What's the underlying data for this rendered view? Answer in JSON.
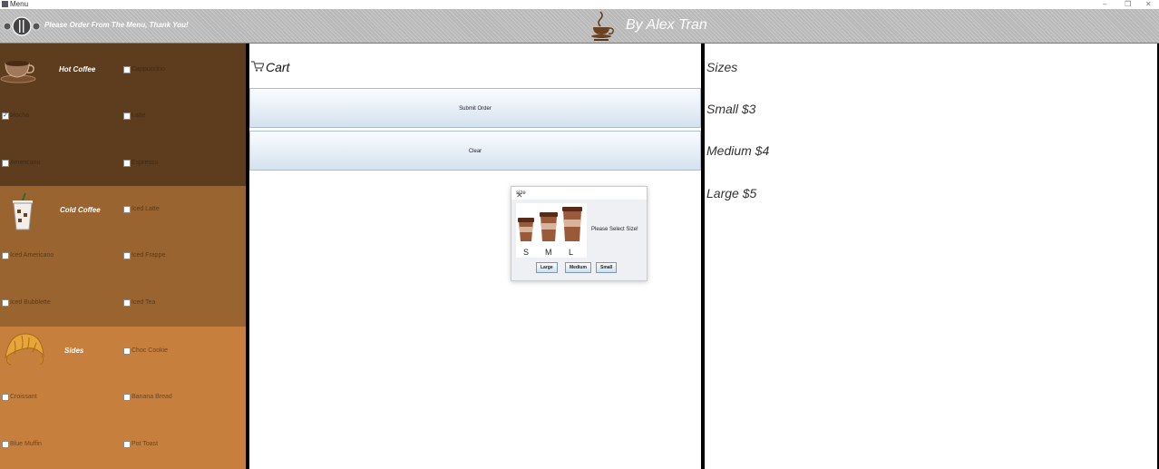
{
  "window": {
    "title": "Menu"
  },
  "header": {
    "instruction": "Please Order From The Menu, Thank You!",
    "author": "By Alex Tran"
  },
  "menu": {
    "hot": {
      "heading": "Hot Coffee",
      "items": [
        {
          "label": "Cappuccino",
          "checked": false
        },
        {
          "label": "Mocha",
          "checked": true
        },
        {
          "label": "Latte",
          "checked": false
        },
        {
          "label": "Americano",
          "checked": false
        },
        {
          "label": "Espresso",
          "checked": false
        }
      ]
    },
    "cold": {
      "heading": "Cold Coffee",
      "items": [
        {
          "label": "Iced Latte",
          "checked": false
        },
        {
          "label": "Iced Americano",
          "checked": false
        },
        {
          "label": "Iced Frappe",
          "checked": false
        },
        {
          "label": "Iced Bubblette",
          "checked": false
        },
        {
          "label": "Iced Tea",
          "checked": false
        }
      ]
    },
    "sides": {
      "heading": "Sides",
      "items": [
        {
          "label": "Choc Cookie",
          "checked": false
        },
        {
          "label": "Croissant",
          "checked": false
        },
        {
          "label": "Banana Bread",
          "checked": false
        },
        {
          "label": "Blue Muffin",
          "checked": false
        },
        {
          "label": "Pot Toast",
          "checked": false
        }
      ]
    }
  },
  "cart": {
    "title": "Cart",
    "submit_label": "Submit Order",
    "clear_label": "Clear"
  },
  "dialog": {
    "title": "size",
    "message": "Please Select Size!",
    "image_letters": [
      "S",
      "M",
      "L"
    ],
    "buttons": [
      "Large",
      "Medium",
      "Small"
    ]
  },
  "sizes": {
    "title": "Sizes",
    "lines": [
      "Small $3",
      "Medium $4",
      "Large $5"
    ]
  },
  "colors": {
    "hot_bg": "#5e3d1e",
    "cold_bg": "#9a6430",
    "sides_bg": "#c67f3c",
    "header_bg": "#b8b8b8",
    "button_gradient_top": "#fafcfe",
    "button_gradient_bottom": "#d4e2ef"
  }
}
